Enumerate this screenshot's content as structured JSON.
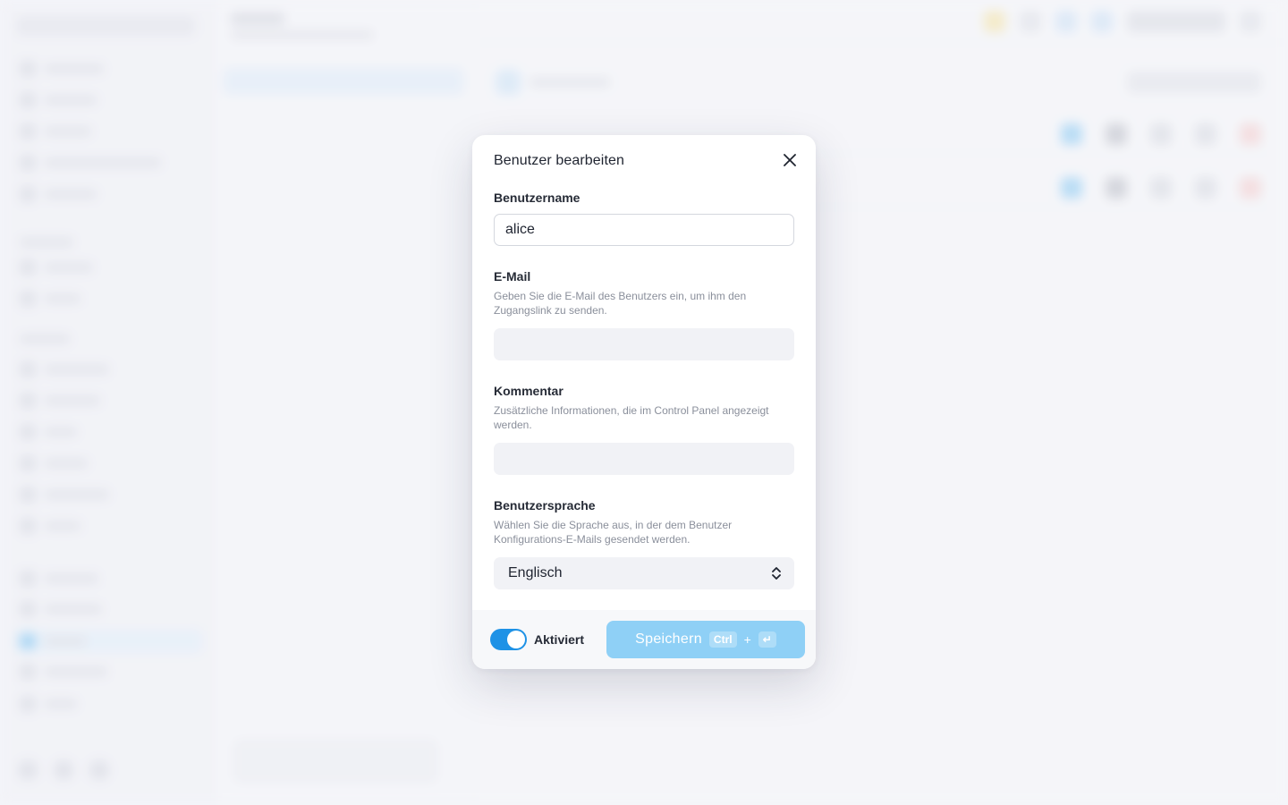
{
  "modal": {
    "title": "Benutzer bearbeiten",
    "fields": {
      "username": {
        "label": "Benutzername",
        "value": "alice"
      },
      "email": {
        "label": "E-Mail",
        "help": "Geben Sie die E-Mail des Benutzers ein, um ihm den Zugangslink zu senden.",
        "value": ""
      },
      "comment": {
        "label": "Kommentar",
        "help": "Zusätzliche Informationen, die im Control Panel angezeigt werden.",
        "value": ""
      },
      "language": {
        "label": "Benutzersprache",
        "help": "Wählen Sie die Sprache aus, in der dem Benutzer Konfigurations-E-Mails gesendet werden.",
        "selected": "Englisch"
      }
    },
    "footer": {
      "toggle_label": "Aktiviert",
      "toggle_on": true,
      "save_label": "Speichern",
      "shortcut_key1": "Ctrl",
      "shortcut_plus": "+",
      "shortcut_key2": "↵"
    }
  },
  "colors": {
    "accent": "#1e92e6",
    "save_button": "#8fd0f6",
    "input_fill": "#f1f2f6"
  },
  "icons": {
    "close": "close-icon",
    "select": "chevron-up-down-icon"
  }
}
